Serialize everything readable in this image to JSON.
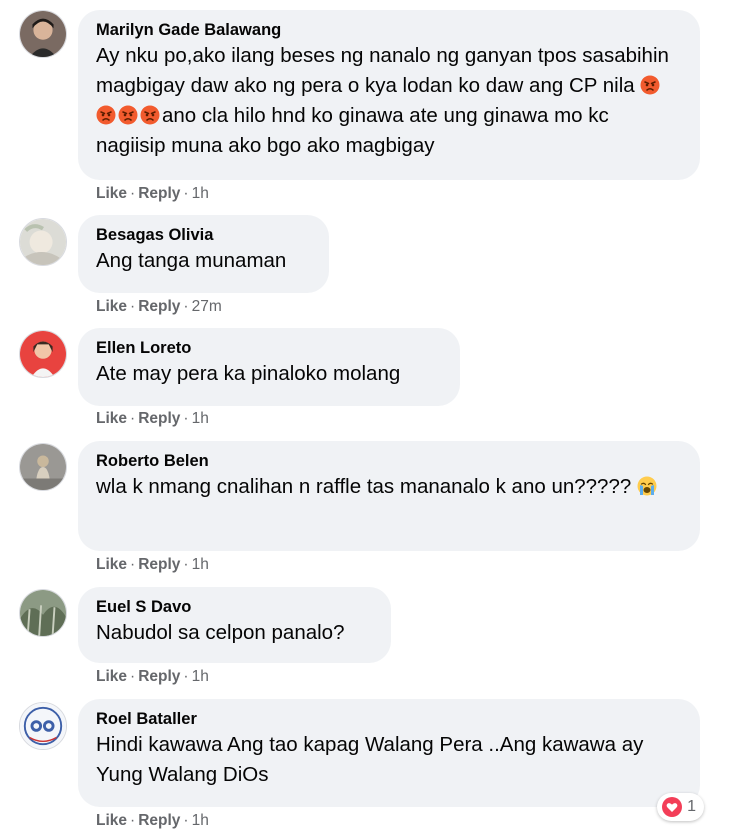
{
  "actions": {
    "like": "Like",
    "reply": "Reply",
    "separator": "·"
  },
  "comments": [
    {
      "author": "Marilyn Gade Balawang",
      "text_before": "Ay nku po,ako ilang beses ng nanalo ng ganyan tpos sasabihin magbigay daw ako ng pera o kya lodan ko daw ang CP nila ",
      "emojis": [
        "angry-face-icon",
        "angry-face-icon",
        "angry-face-icon",
        "angry-face-icon"
      ],
      "text_after": "ano cla hilo hnd ko ginawa ate ung ginawa mo kc nagiisip muna ako bgo ako magbigay",
      "time": "1h"
    },
    {
      "author": "Besagas Olivia",
      "text": "Ang tanga munaman",
      "time": "27m"
    },
    {
      "author": "Ellen Loreto",
      "text": "Ate may pera ka pinaloko molang",
      "time": "1h"
    },
    {
      "author": "Roberto Belen",
      "text": "wla k nmang cnalihan n raffle tas mananalo k ano un????? ",
      "emoji": "loudly-crying-face-icon",
      "time": "1h"
    },
    {
      "author": "Euel S Davo",
      "text": "Nabudol sa celpon panalo?",
      "time": "1h"
    },
    {
      "author": "Roel Bataller",
      "text": "Hindi kawawa Ang tao kapag Walang Pera ..Ang kawawa ay Yung Walang DiOs",
      "time": "1h",
      "reaction": {
        "icon": "love-reaction-icon",
        "count": "1"
      }
    }
  ],
  "colors": {
    "bubble": "#f0f2f5",
    "meta": "#65676b",
    "text": "#050505",
    "love": "#f33e58"
  }
}
